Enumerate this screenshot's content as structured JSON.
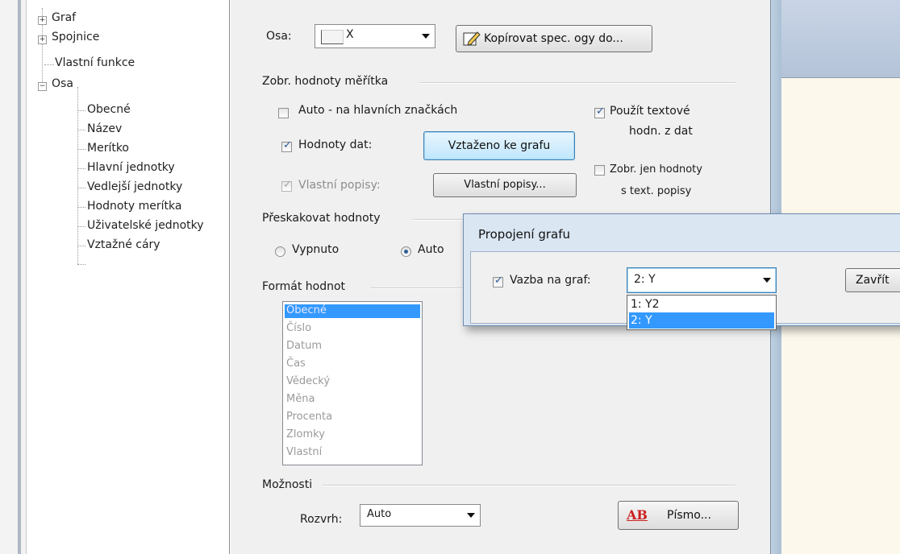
{
  "tree": {
    "items": [
      {
        "label": "Graf",
        "expander": "+"
      },
      {
        "label": "Spojnice",
        "expander": "+"
      },
      {
        "label": "Vlastní funkce"
      },
      {
        "label": "Osa",
        "expander": "−"
      },
      {
        "label": "Obecné"
      },
      {
        "label": "Název"
      },
      {
        "label": "Merítko"
      },
      {
        "label": "Hlavní jednotky"
      },
      {
        "label": "Vedlejší jednotky"
      },
      {
        "label": "Hodnoty merítka"
      },
      {
        "label": "Uživatelské jednotky"
      },
      {
        "label": "Vztažné cáry"
      }
    ]
  },
  "axis": {
    "label": "Osa:",
    "value": "X",
    "copy_button": "Kopírovat spec. ogy do..."
  },
  "scale_values": {
    "title": "Zobr. hodnoty měřítka",
    "auto_label": "Auto - na hlavních značkách",
    "auto_checked": false,
    "use_text_label_line1": "Použít textové",
    "use_text_label_line2": "hodn. z dat",
    "use_text_checked": true,
    "data_values_label": "Hodnoty dat:",
    "data_values_checked": true,
    "data_values_button": "Vztaženo ke grafu",
    "custom_labels_label": "Vlastní popisy:",
    "custom_labels_checked": true,
    "custom_labels_button": "Vlastní popisy...",
    "only_text_line1": "Zobr. jen hodnoty",
    "only_text_line2": "s text. popisy",
    "only_text_checked": false
  },
  "skip": {
    "title": "Přeskakovat hodnoty",
    "off_label": "Vypnuto",
    "auto_label": "Auto",
    "selected": "Auto"
  },
  "format": {
    "title": "Formát hodnot",
    "items": [
      "Obecné",
      "Číslo",
      "Datum",
      "Čas",
      "Vědecký",
      "Měna",
      "Procenta",
      "Zlomky",
      "Vlastní"
    ],
    "selected": "Obecné"
  },
  "options": {
    "title": "Možnosti",
    "layout_label": "Rozvrh:",
    "layout_value": "Auto",
    "font_icon_text": "AB",
    "font_button": "Písmo..."
  },
  "popup": {
    "title": "Propojení grafu",
    "link_label": "Vazba na graf:",
    "link_checked": true,
    "combo_value": "2: Y",
    "close_button": "Zavřít",
    "options": [
      "1: Y2",
      "2: Y"
    ],
    "selected_option": "2: Y"
  },
  "colors": {
    "selection": "#3399ff",
    "check_mark": "#2a5e9f",
    "focus_border": "#3c7fb1",
    "popup_frame": "#dbe6f3"
  }
}
